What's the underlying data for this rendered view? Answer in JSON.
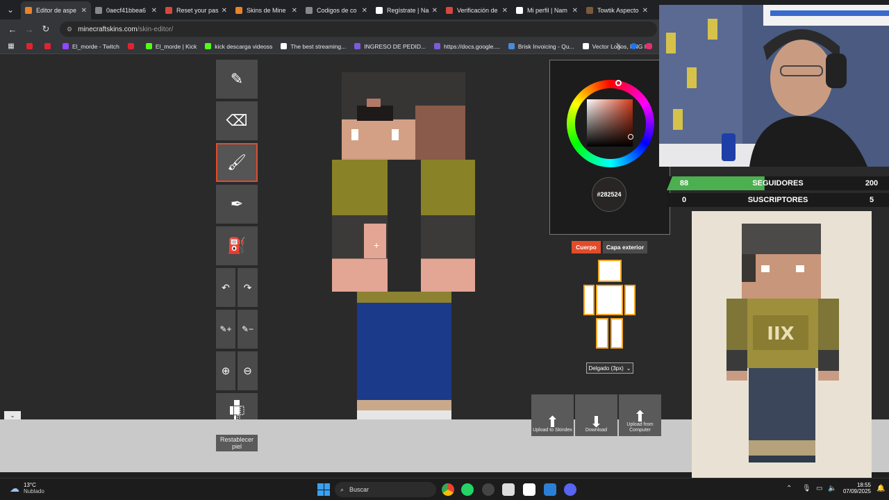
{
  "browser": {
    "tabs": [
      {
        "label": "Editor de aspe",
        "color": "#e8832a",
        "active": true
      },
      {
        "label": "0aecf41bbea6",
        "color": "#888888"
      },
      {
        "label": "Reset your pas",
        "color": "#d8473c"
      },
      {
        "label": "Skins de Mine",
        "color": "#e8832a"
      },
      {
        "label": "Codigos de co",
        "color": "#888888"
      },
      {
        "label": "Regístrate | Na",
        "color": "#ffffff"
      },
      {
        "label": "Verificación de",
        "color": "#d8473c"
      },
      {
        "label": "Mi perfil | Nam",
        "color": "#ffffff"
      },
      {
        "label": "Towtik Aspecto",
        "color": "#7a5a3a"
      }
    ],
    "url_host": "minecraftskins.com",
    "url_path": "/skin-editor/",
    "bookmarks": [
      {
        "label": "",
        "color": "#e0242f"
      },
      {
        "label": "",
        "color": "#e0242f"
      },
      {
        "label": "El_morde - Twitch",
        "color": "#9146ff"
      },
      {
        "label": "",
        "color": "#e0242f"
      },
      {
        "label": "El_morde | Kick",
        "color": "#53fc18"
      },
      {
        "label": "kick descarga videoss",
        "color": "#53fc18"
      },
      {
        "label": "The best streaming...",
        "color": "#ffffff"
      },
      {
        "label": "INGRESO DE PEDID...",
        "color": "#7b5cd6"
      },
      {
        "label": "https://docs.google....",
        "color": "#7b5cd6"
      },
      {
        "label": "Brisk Invoicing - Qu...",
        "color": "#4a8ad6"
      },
      {
        "label": "Vector Logos, PNG I...",
        "color": "#ffffff"
      }
    ]
  },
  "editor": {
    "tools": [
      {
        "name": "pencil-tool",
        "icon": "✎"
      },
      {
        "name": "eraser-tool",
        "icon": "⌫"
      },
      {
        "name": "brush-tool",
        "icon": "🖌"
      },
      {
        "name": "eyedropper-tool",
        "icon": "✒"
      },
      {
        "name": "bucket-tool",
        "icon": "⛽"
      }
    ],
    "reset_label": "Restablecer piel",
    "color_hex": "#282524",
    "layers": {
      "body": "Cuerpo",
      "outer": "Capa exterior"
    },
    "slim_option": "Delgado (3px)",
    "actions": [
      {
        "label": "Upload to Skindex",
        "icon": "⬆"
      },
      {
        "label": "Download",
        "icon": "⬇"
      },
      {
        "label": "Upload from Computer",
        "icon": "⬆"
      }
    ]
  },
  "stream": {
    "followers": {
      "current": "88",
      "label": "SEGUIDORES",
      "goal": "200",
      "progress": 0.44
    },
    "subscribers": {
      "current": "0",
      "label": "SUSCRIPTORES",
      "goal": "5",
      "progress": 0
    }
  },
  "taskbar": {
    "weather_temp": "13°C",
    "weather_desc": "Nublado",
    "search_placeholder": "Buscar",
    "time": "18:55",
    "date": "07/09/2025"
  },
  "colors": {
    "accent": "#e24c2a",
    "layer_active": "#e24c2a",
    "layer_inactive": "#4a4a4a"
  }
}
